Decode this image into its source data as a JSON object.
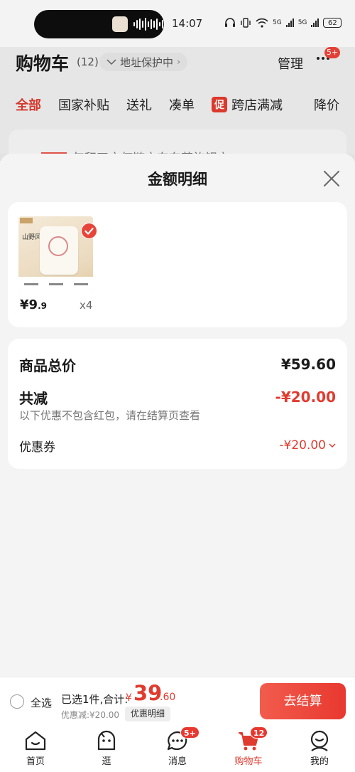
{
  "status_bar": {
    "time": "14:07",
    "network": "5G",
    "battery": "62"
  },
  "background": {
    "title": "购物车",
    "count": "(12)",
    "address_protect": "地址保护中",
    "manage": "管理",
    "more_badge": "5+",
    "tabs": [
      "全部",
      "国家补贴",
      "送礼",
      "凑单",
      "跨店满减",
      "降价"
    ],
    "promo_tag": "促",
    "peek_text": "年积四方何链文东东苏族银市"
  },
  "sheet": {
    "title": "金额明细",
    "product": {
      "image_text": "山野风铃",
      "price_int": "¥9",
      "price_dec": ".9",
      "qty": "x4"
    },
    "summary": {
      "total_label": "商品总价",
      "total_value": "¥59.60",
      "reduce_label": "共减",
      "reduce_value": "-¥20.00",
      "reduce_note": "以下优惠不包含红包，请在结算页查看",
      "coupon_label": "优惠券",
      "coupon_value": "-¥20.00"
    }
  },
  "checkout": {
    "select_all": "全选",
    "selected_text": "已选1件,合计:",
    "yen": "¥",
    "total_int": "39",
    "total_dec": ".60",
    "discount_text": "优惠减:¥20.00",
    "detail_chip": "优惠明细",
    "button": "去结算"
  },
  "tabbar": {
    "items": [
      {
        "label": "首页",
        "icon": "home-icon"
      },
      {
        "label": "逛",
        "icon": "stroll-icon"
      },
      {
        "label": "消息",
        "icon": "message-icon",
        "badge": "5+"
      },
      {
        "label": "购物车",
        "icon": "cart-icon",
        "badge": "12",
        "active": true
      },
      {
        "label": "我的",
        "icon": "profile-icon"
      }
    ]
  },
  "colors": {
    "accent": "#e03b2f",
    "sheet_bg": "#f4f4f4",
    "card_bg": "#ffffff"
  }
}
